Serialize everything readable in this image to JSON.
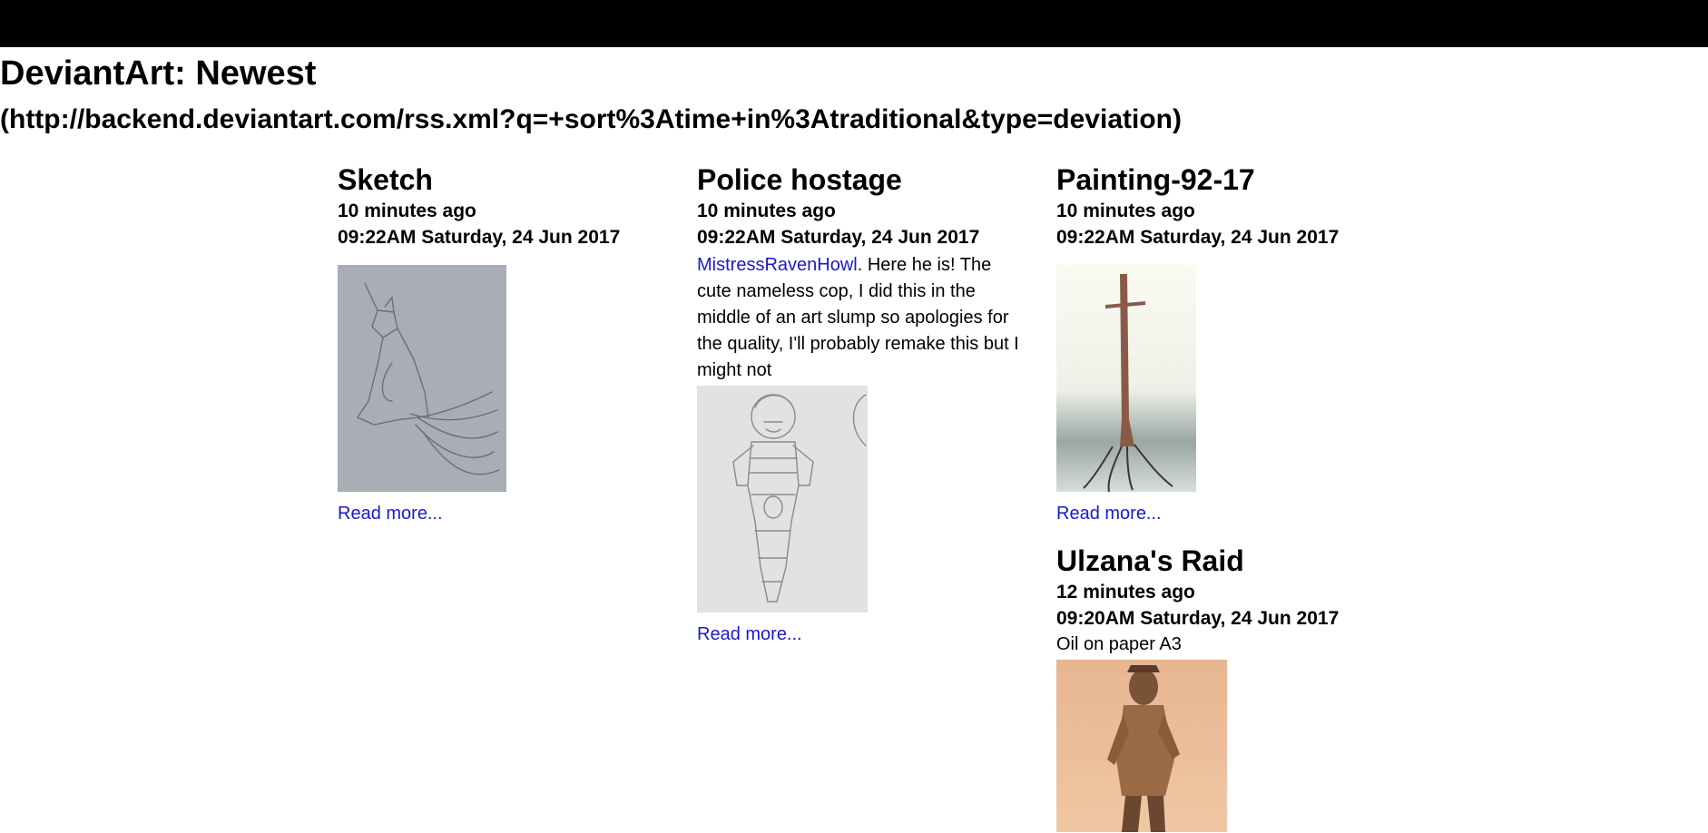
{
  "feed": {
    "title": "DeviantArt: Newest",
    "url": "(http://backend.deviantart.com/rss.xml?q=+sort%3Atime+in%3Atraditional&type=deviation)"
  },
  "items": [
    {
      "title": "Sketch",
      "relative_time": "10 minutes ago",
      "datetime": "09:22AM Saturday, 24 Jun 2017",
      "read_more": "Read more..."
    },
    {
      "title": "Police hostage",
      "relative_time": "10 minutes ago",
      "datetime": "09:22AM Saturday, 24 Jun 2017",
      "desc_link": "MistressRavenHowl",
      "desc_text": ". Here he is! The cute nameless cop, I did this in the middle of an art slump so apologies for the quality, I'll probably remake this but I might not",
      "read_more": "Read more..."
    },
    {
      "title": "Painting-92-17",
      "relative_time": "10 minutes ago",
      "datetime": "09:22AM Saturday, 24 Jun 2017",
      "read_more": "Read more..."
    },
    {
      "title": "Ulzana's Raid",
      "relative_time": "12 minutes ago",
      "datetime": "09:20AM Saturday, 24 Jun 2017",
      "desc_text": "Oil on paper A3"
    }
  ],
  "colors": {
    "link": "#1a1acc",
    "topbar": "#000000"
  }
}
